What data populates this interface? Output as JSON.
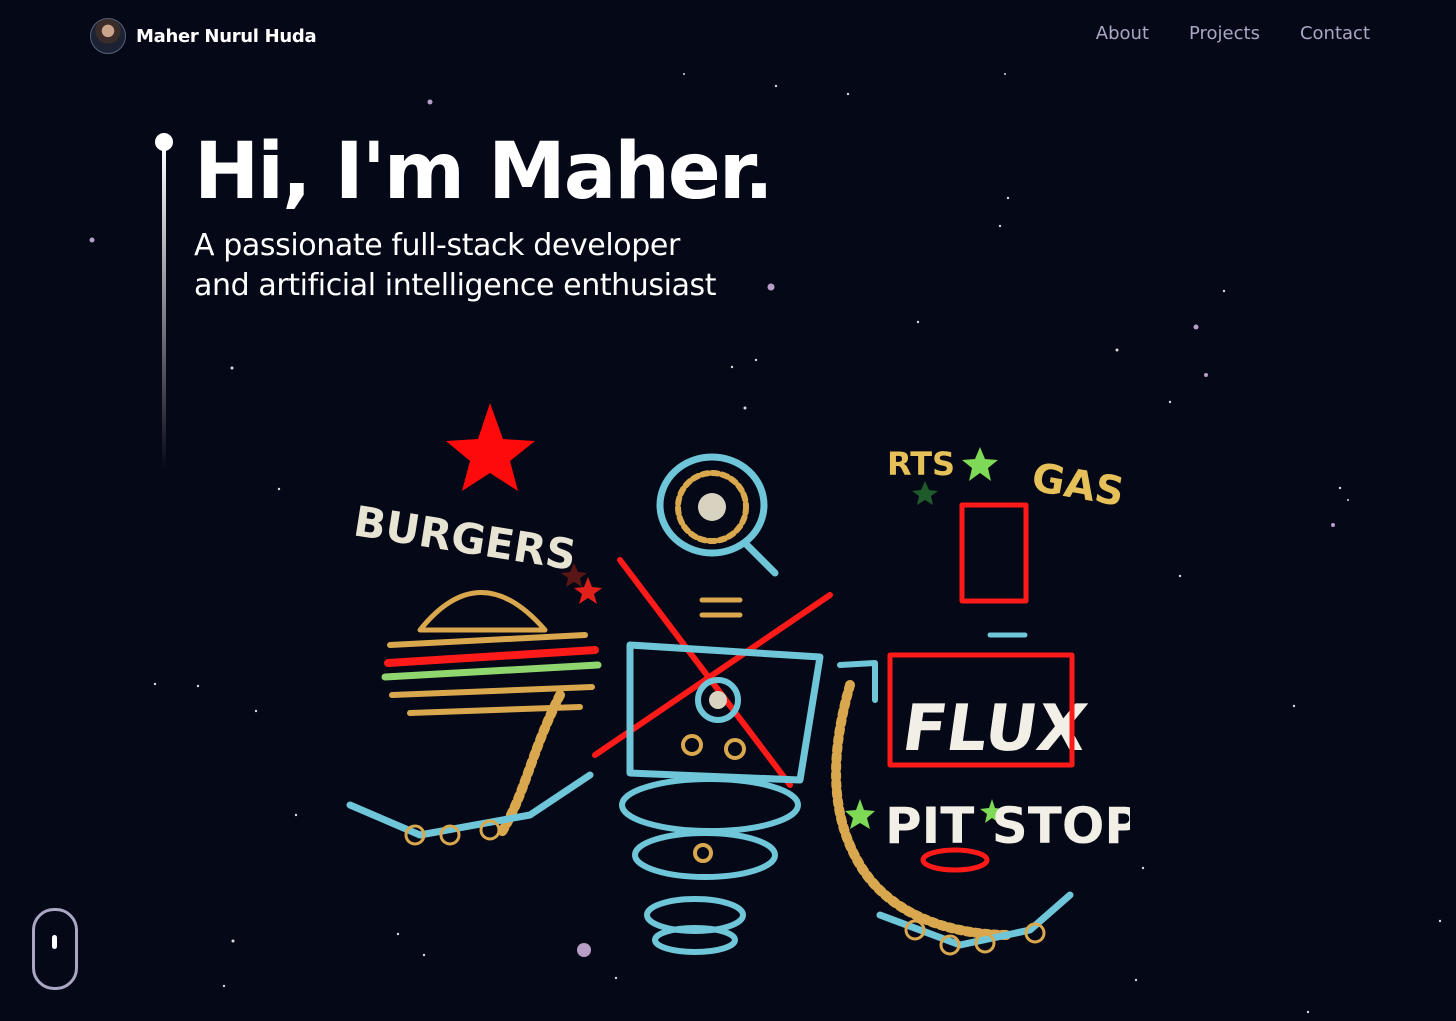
{
  "nav": {
    "brand_name": "Maher Nurul Huda",
    "links": [
      {
        "label": "About"
      },
      {
        "label": "Projects"
      },
      {
        "label": "Contact"
      }
    ]
  },
  "hero": {
    "title": "Hi, I'm Maher.",
    "subtitle_line1": "A passionate full-stack developer",
    "subtitle_line2": "and artificial intelligence enthusiast"
  },
  "scene": {
    "signs": [
      "BURGERS",
      "GAS",
      "FLUX",
      "PIT STOP"
    ]
  },
  "colors": {
    "background": "#050816",
    "nav_link": "#aaa6c3",
    "robot_blue": "#6ec6d8",
    "robot_red": "#ff1a1a",
    "robot_gold": "#d9a84e",
    "star_green": "#7ed957"
  },
  "icons": {
    "scroll_indicator": "mouse-scroll-icon"
  }
}
